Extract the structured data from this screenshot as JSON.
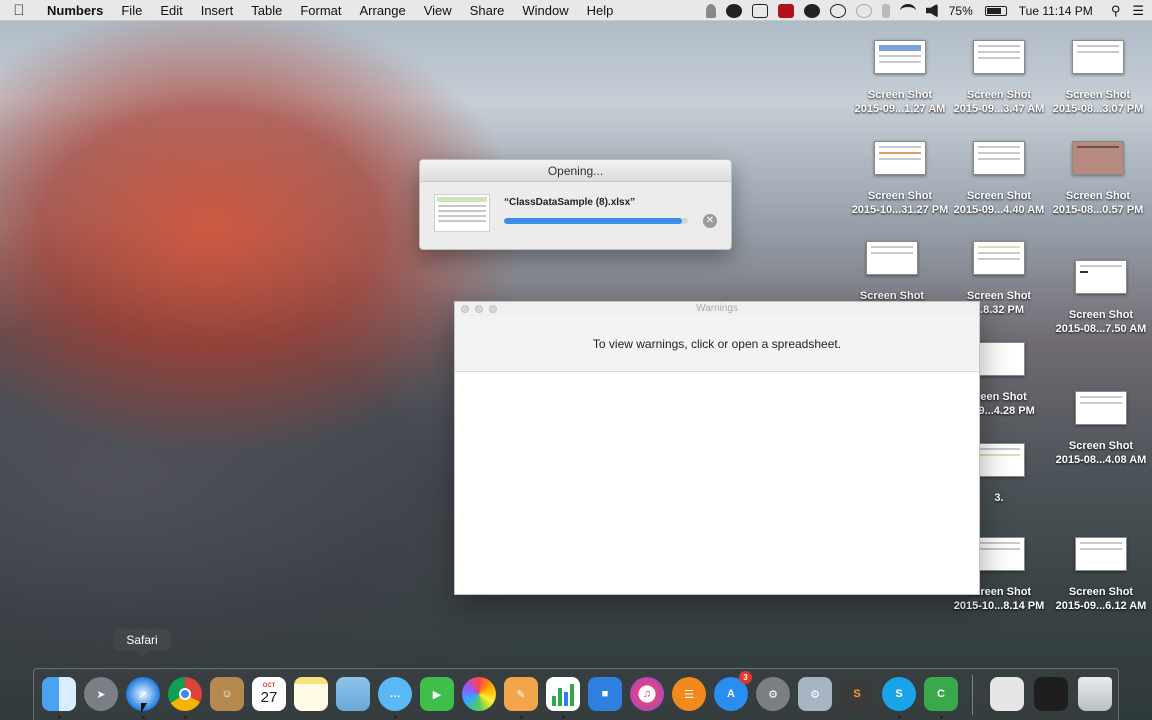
{
  "menubar": {
    "app_name": "Numbers",
    "items": [
      "File",
      "Edit",
      "Insert",
      "Table",
      "Format",
      "Arrange",
      "View",
      "Share",
      "Window",
      "Help"
    ],
    "battery": "75%",
    "clock": "Tue 11:14 PM"
  },
  "opening_dialog": {
    "title": "Opening...",
    "filename": "“ClassDataSample (8).xlsx”",
    "progress": 0.97
  },
  "warnings_window": {
    "title": "Warnings",
    "message": "To view warnings, click or open a spreadsheet."
  },
  "desktop_files": [
    {
      "line1": "Screen Shot",
      "line2": "2015-09...1.27 AM"
    },
    {
      "line1": "Screen Shot",
      "line2": "2015-09...3.47 AM"
    },
    {
      "line1": "Screen Shot",
      "line2": "2015-08...3.07 PM"
    },
    {
      "line1": "Screen Shot",
      "line2": "2015-10...31.27 PM"
    },
    {
      "line1": "Screen Shot",
      "line2": "2015-09...4.40 AM"
    },
    {
      "line1": "Screen Shot",
      "line2": "2015-08...0.57 PM"
    },
    {
      "line1": "Screen Shot",
      "line2": ""
    },
    {
      "line1": "Screen Shot",
      "line2": "...8.32 PM"
    },
    {
      "line1": "Screen Shot",
      "line2": "2015-08...7.50 AM"
    },
    {
      "line1": "...een Shot",
      "line2": "...09...4.28 PM"
    },
    {
      "line1": "Screen Shot",
      "line2": "2015-08...4.08 AM"
    },
    {
      "line1": "3.",
      "line2": ""
    },
    {
      "line1": "Screen Shot",
      "line2": "2015-10...8.14 PM"
    },
    {
      "line1": "Screen Shot",
      "line2": "2015-09...6.12 AM"
    }
  ],
  "tooltip": "Safari",
  "dock": {
    "calendar_month": "OCT",
    "calendar_day": "27",
    "appstore_badge": "3",
    "items": [
      "finder-icon",
      "launchpad-icon",
      "safari-icon",
      "chrome-icon",
      "contacts-icon",
      "calendar-icon",
      "notes-icon",
      "preview-icon",
      "messages-icon",
      "facetime-icon",
      "photos-icon",
      "pages-icon",
      "numbers-icon",
      "keynote-icon",
      "itunes-icon",
      "ibooks-icon",
      "app-store-icon",
      "system-preferences-icon",
      "utilities-icon",
      "sublime-icon",
      "skype-icon",
      "camtasia-icon",
      "document-icon",
      "screen-icon",
      "trash-icon"
    ]
  }
}
